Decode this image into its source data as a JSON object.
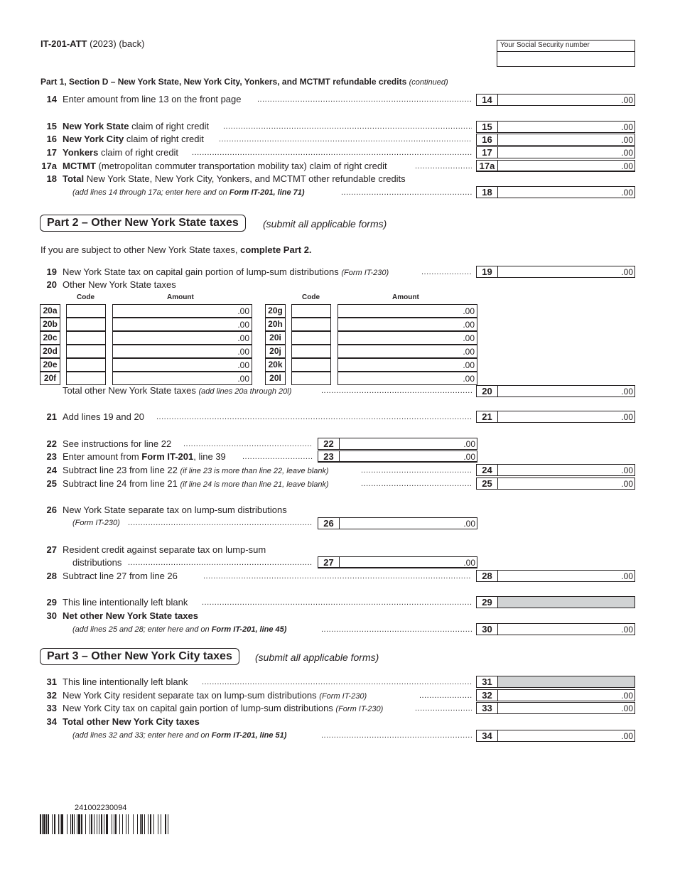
{
  "header": {
    "form_id": "IT-201-ATT",
    "form_year": "(2023) (back)",
    "ssn_label": "Your Social Security number",
    "ssn_value": ""
  },
  "section_d": {
    "title": "Part 1, Section D – New York State, New York City, Yonkers, and MCTMT refundable credits",
    "title_note": "(continued)",
    "lines": [
      {
        "num": "14",
        "bold": "",
        "text": "Enter amount from line 13 on the front page",
        "box": "14",
        "amount": ".00"
      },
      {
        "num": "15",
        "bold": "New York State",
        "text": " claim of right credit",
        "box": "15",
        "amount": ".00"
      },
      {
        "num": "16",
        "bold": "New York City",
        "text": " claim of right credit",
        "box": "16",
        "amount": ".00"
      },
      {
        "num": "17",
        "bold": "Yonkers",
        "text": " claim of right credit",
        "box": "17",
        "amount": ".00"
      },
      {
        "num": "17a",
        "bold": "MCTMT",
        "text": " (metropolitan commuter transportation mobility tax) claim of right credit",
        "box": "17a",
        "amount": ".00"
      }
    ],
    "line18": {
      "num": "18",
      "bold": "Total",
      "text": " New York State, New York City, Yonkers, and MCTMT other refundable credits",
      "sub_pre": "(add lines 14 through 17a; enter here and on ",
      "sub_bold": "Form IT-201, line 71)",
      "box": "18",
      "amount": ".00"
    }
  },
  "part2": {
    "title": "Part 2 – Other New York State taxes",
    "note": "(submit all applicable forms)",
    "intro_pre": "If you are subject to other New York State taxes, ",
    "intro_bold": "complete Part 2.",
    "line19": {
      "num": "19",
      "text": "New York State tax on capital gain portion of lump-sum distributions ",
      "note": "(Form IT-230)",
      "box": "19",
      "amount": ".00"
    },
    "line20": {
      "num": "20",
      "text": "Other New York State taxes",
      "code_header": "Code",
      "amount_header": "Amount",
      "left_rows": [
        {
          "label": "20a",
          "code": "",
          "amount": ".00"
        },
        {
          "label": "20b",
          "code": "",
          "amount": ".00"
        },
        {
          "label": "20c",
          "code": "",
          "amount": ".00"
        },
        {
          "label": "20d",
          "code": "",
          "amount": ".00"
        },
        {
          "label": "20e",
          "code": "",
          "amount": ".00"
        },
        {
          "label": "20f",
          "code": "",
          "amount": ".00"
        }
      ],
      "right_rows": [
        {
          "label": "20g",
          "code": "",
          "amount": ".00"
        },
        {
          "label": "20h",
          "code": "",
          "amount": ".00"
        },
        {
          "label": "20i",
          "code": "",
          "amount": ".00"
        },
        {
          "label": "20j",
          "code": "",
          "amount": ".00"
        },
        {
          "label": "20k",
          "code": "",
          "amount": ".00"
        },
        {
          "label": "20l",
          "code": "",
          "amount": ".00"
        }
      ],
      "total_text": "Total other New York State taxes ",
      "total_note": "(add lines 20a through 20l)",
      "box": "20",
      "amount": ".00"
    },
    "line21": {
      "num": "21",
      "text": "Add lines 19 and 20",
      "box": "21",
      "amount": ".00"
    },
    "line22": {
      "num": "22",
      "text": "See instructions for line 22",
      "box": "22",
      "amount": ".00"
    },
    "line23": {
      "num": "23",
      "text_pre": "Enter amount from ",
      "text_bold": "Form IT-201",
      "text_post": ", line 39",
      "box": "23",
      "amount": ".00"
    },
    "line24": {
      "num": "24",
      "text": "Subtract line 23 from line 22 ",
      "note": "(if line 23 is more than line 22, leave blank)",
      "box": "24",
      "amount": ".00"
    },
    "line25": {
      "num": "25",
      "text": "Subtract line 24 from line 21 ",
      "note": "(if line 24 is more than line 21, leave blank)",
      "box": "25",
      "amount": ".00"
    },
    "line26": {
      "num": "26",
      "text": "New York State separate tax on lump-sum distributions",
      "sub": "(Form IT-230)",
      "box": "26",
      "amount": ".00"
    },
    "line27": {
      "num": "27",
      "text": "Resident credit against separate tax on lump-sum",
      "sub": "distributions",
      "box": "27",
      "amount": ".00"
    },
    "line28": {
      "num": "28",
      "text": "Subtract line 27 from line 26",
      "box": "28",
      "amount": ".00"
    },
    "line29": {
      "num": "29",
      "text": "This line intentionally left blank",
      "box": "29"
    },
    "line30": {
      "num": "30",
      "text": "Net other New York State taxes",
      "sub_pre": "(add lines 25 and 28; enter here and on ",
      "sub_bold": "Form IT-201, line 45)",
      "box": "30",
      "amount": ".00"
    }
  },
  "part3": {
    "title": "Part 3 – Other New York City taxes",
    "note": "(submit all applicable forms)",
    "line31": {
      "num": "31",
      "text": "This line intentionally left blank",
      "box": "31"
    },
    "line32": {
      "num": "32",
      "text": "New York City resident separate tax on lump-sum distributions ",
      "note": "(Form IT-230)",
      "box": "32",
      "amount": ".00"
    },
    "line33": {
      "num": "33",
      "text": "New York City tax on capital gain portion of lump-sum distributions ",
      "note": "(Form IT-230)",
      "box": "33",
      "amount": ".00"
    },
    "line34": {
      "num": "34",
      "text": "Total other New York City taxes",
      "sub_pre": "(add lines 32 and 33; enter here and on ",
      "sub_bold": "Form IT-201, line 51)",
      "box": "34",
      "amount": ".00"
    }
  },
  "footer": {
    "barcode_number": "241002230094"
  }
}
